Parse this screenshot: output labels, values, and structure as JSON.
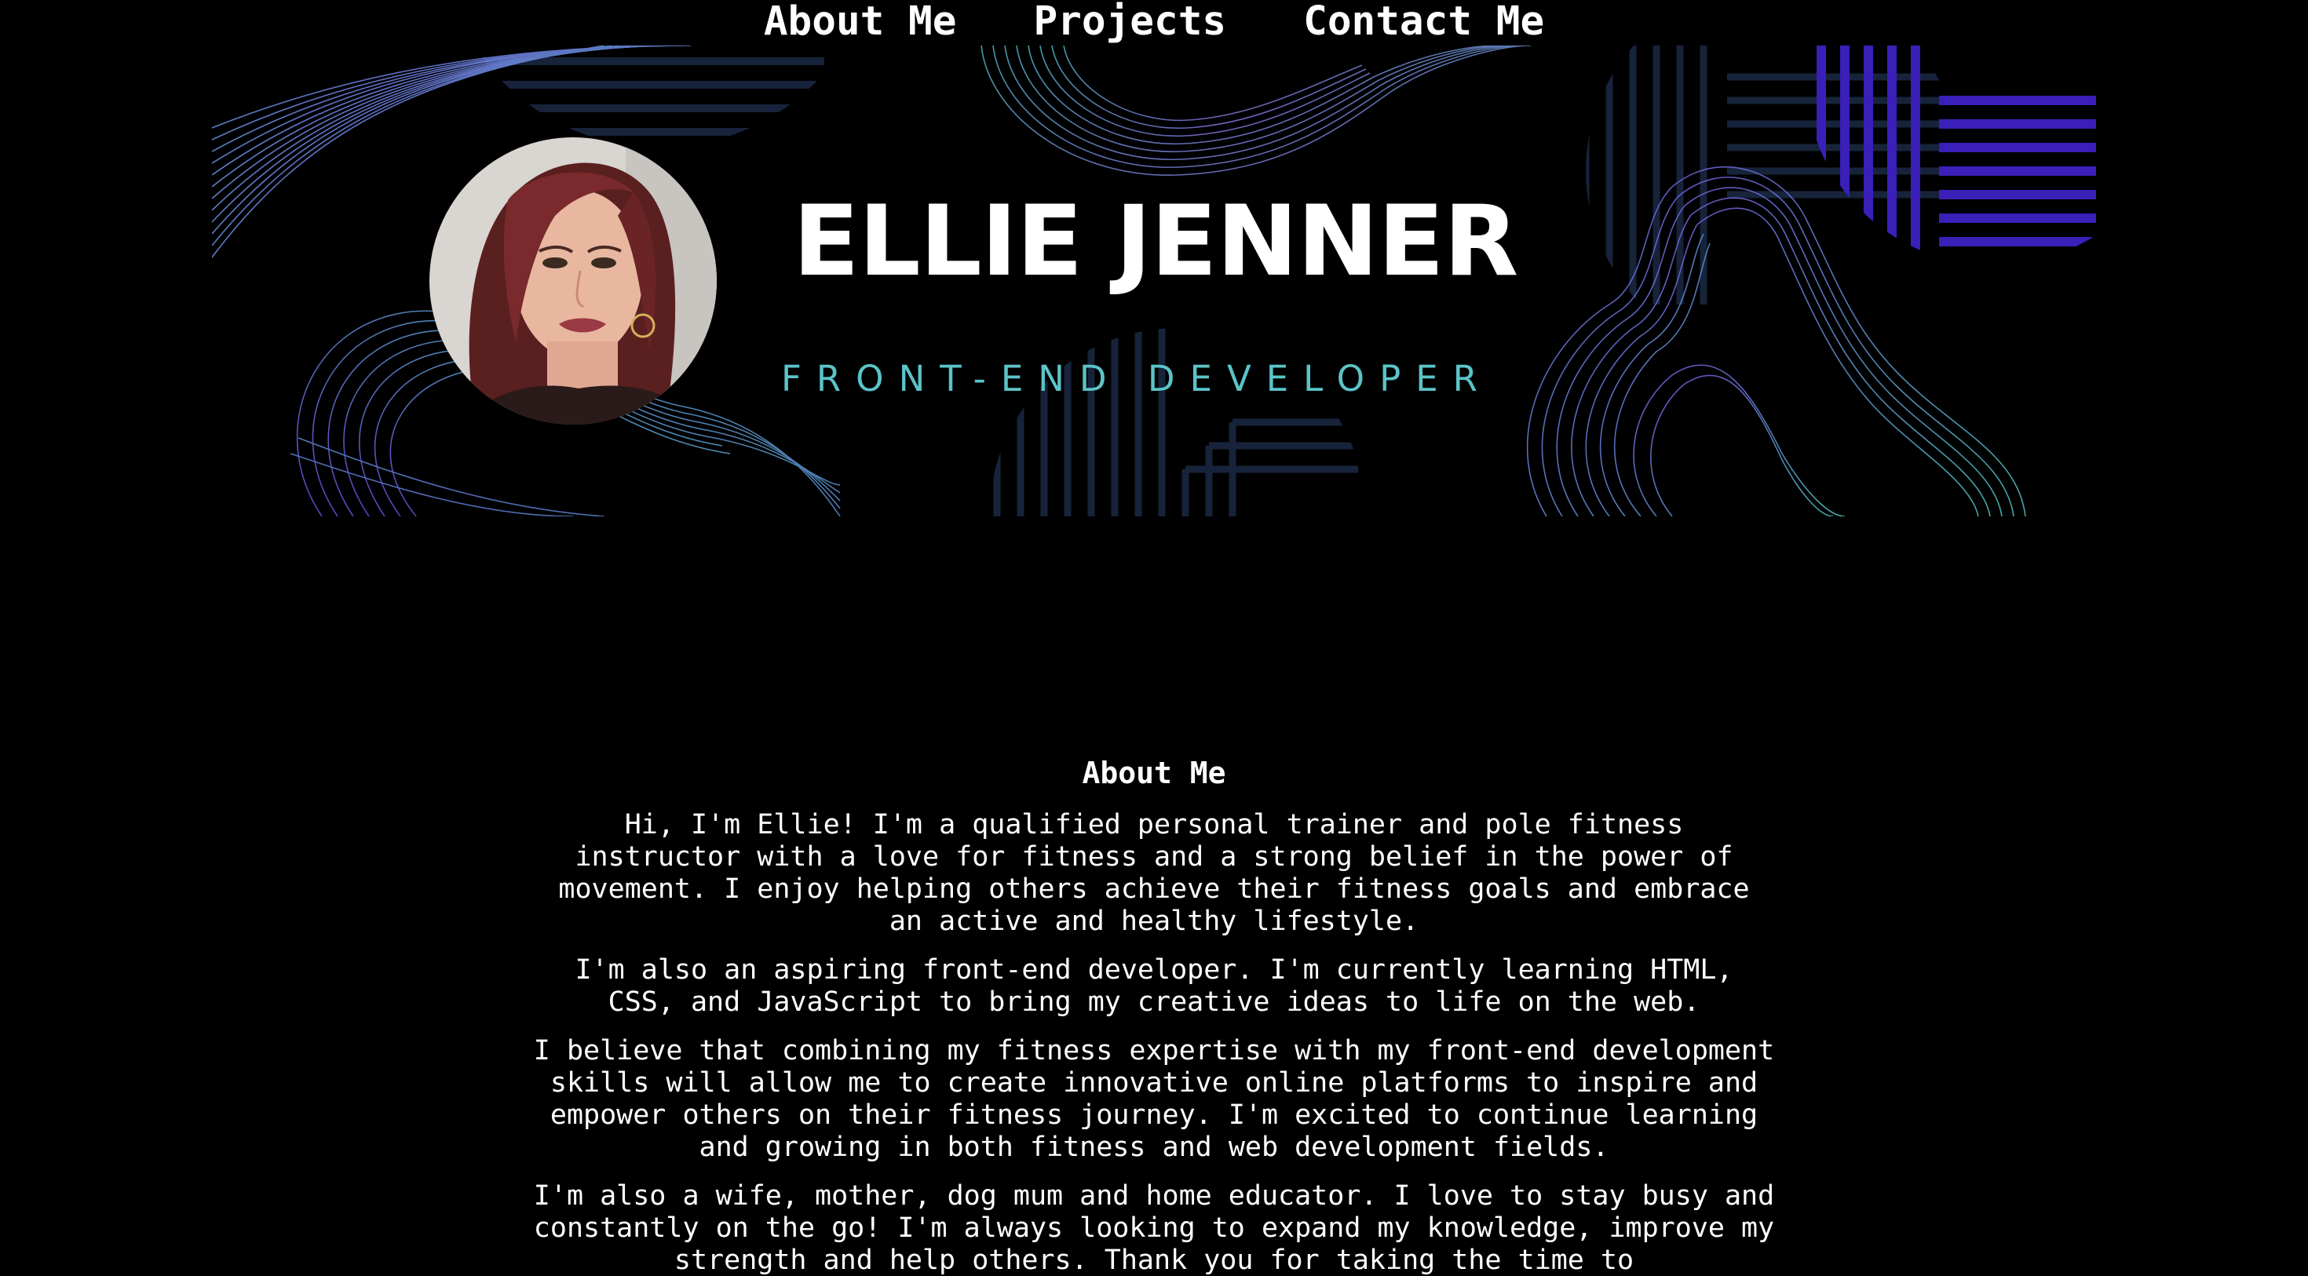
{
  "nav": {
    "items": [
      {
        "label": "About Me"
      },
      {
        "label": "Projects"
      },
      {
        "label": "Contact Me"
      }
    ]
  },
  "banner": {
    "name": "ELLIE JENNER",
    "role": "FRONT-END DEVELOPER"
  },
  "about": {
    "heading": "About Me",
    "paragraphs": [
      "Hi, I'm Ellie! I'm a qualified personal trainer and pole fitness instructor with a love for fitness and a strong belief in the power of movement. I enjoy helping others achieve their fitness goals and embrace an active and healthy lifestyle.",
      "I'm also an aspiring front-end developer. I'm currently learning HTML, CSS, and JavaScript to bring my creative ideas to life on the web.",
      "I believe that combining my fitness expertise with my front-end development skills will allow me to create innovative online platforms to inspire and empower others on their fitness journey. I'm excited to continue learning and growing in both fitness and web development fields.",
      "I'm also a wife, mother, dog mum and home educator. I love to stay busy and constantly on the go! I'm always looking to expand my knowledge, improve my strength and help others. Thank you for taking the time to"
    ]
  },
  "colors": {
    "background": "#000000",
    "text": "#ffffff",
    "role_accent": "#5bc4c8",
    "wave_teal": "#4fc6c4",
    "wave_purple": "#7a55e6",
    "stripe_violet": "#3a1fb8",
    "stripe_navy": "#17233a"
  },
  "icons": {
    "avatar": "profile-photo"
  }
}
